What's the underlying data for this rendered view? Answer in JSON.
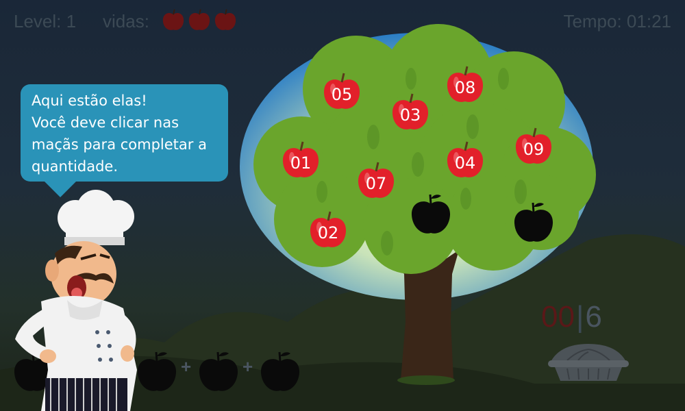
{
  "hud": {
    "level_text": "Level: 1",
    "lives_label": "vidas:",
    "lives_count": 3,
    "timer_text": "Tempo: 01:21"
  },
  "speech": {
    "lines": [
      "Aqui estão elas!",
      "Você deve clicar nas",
      "maçãs para completar a",
      "quantidade."
    ]
  },
  "tree_apples": [
    {
      "label": "05",
      "color": "#e2202a"
    },
    {
      "label": "03",
      "color": "#e2202a"
    },
    {
      "label": "08",
      "color": "#e2202a"
    },
    {
      "label": "01",
      "color": "#e2202a"
    },
    {
      "label": "07",
      "color": "#e2202a"
    },
    {
      "label": "04",
      "color": "#e2202a"
    },
    {
      "label": "09",
      "color": "#e2202a"
    },
    {
      "label": "02",
      "color": "#e2202a"
    }
  ],
  "tree_empty_slots": 2,
  "equation": {
    "slots": 5,
    "operator": "+"
  },
  "counter": {
    "current": "00",
    "separator": "|",
    "target": "6"
  },
  "colors": {
    "apple_red": "#e2202a",
    "bubble_blue": "#2a93b8",
    "leaf_green": "#6aa52c",
    "apple_silhouette": "#0a0a0a"
  }
}
